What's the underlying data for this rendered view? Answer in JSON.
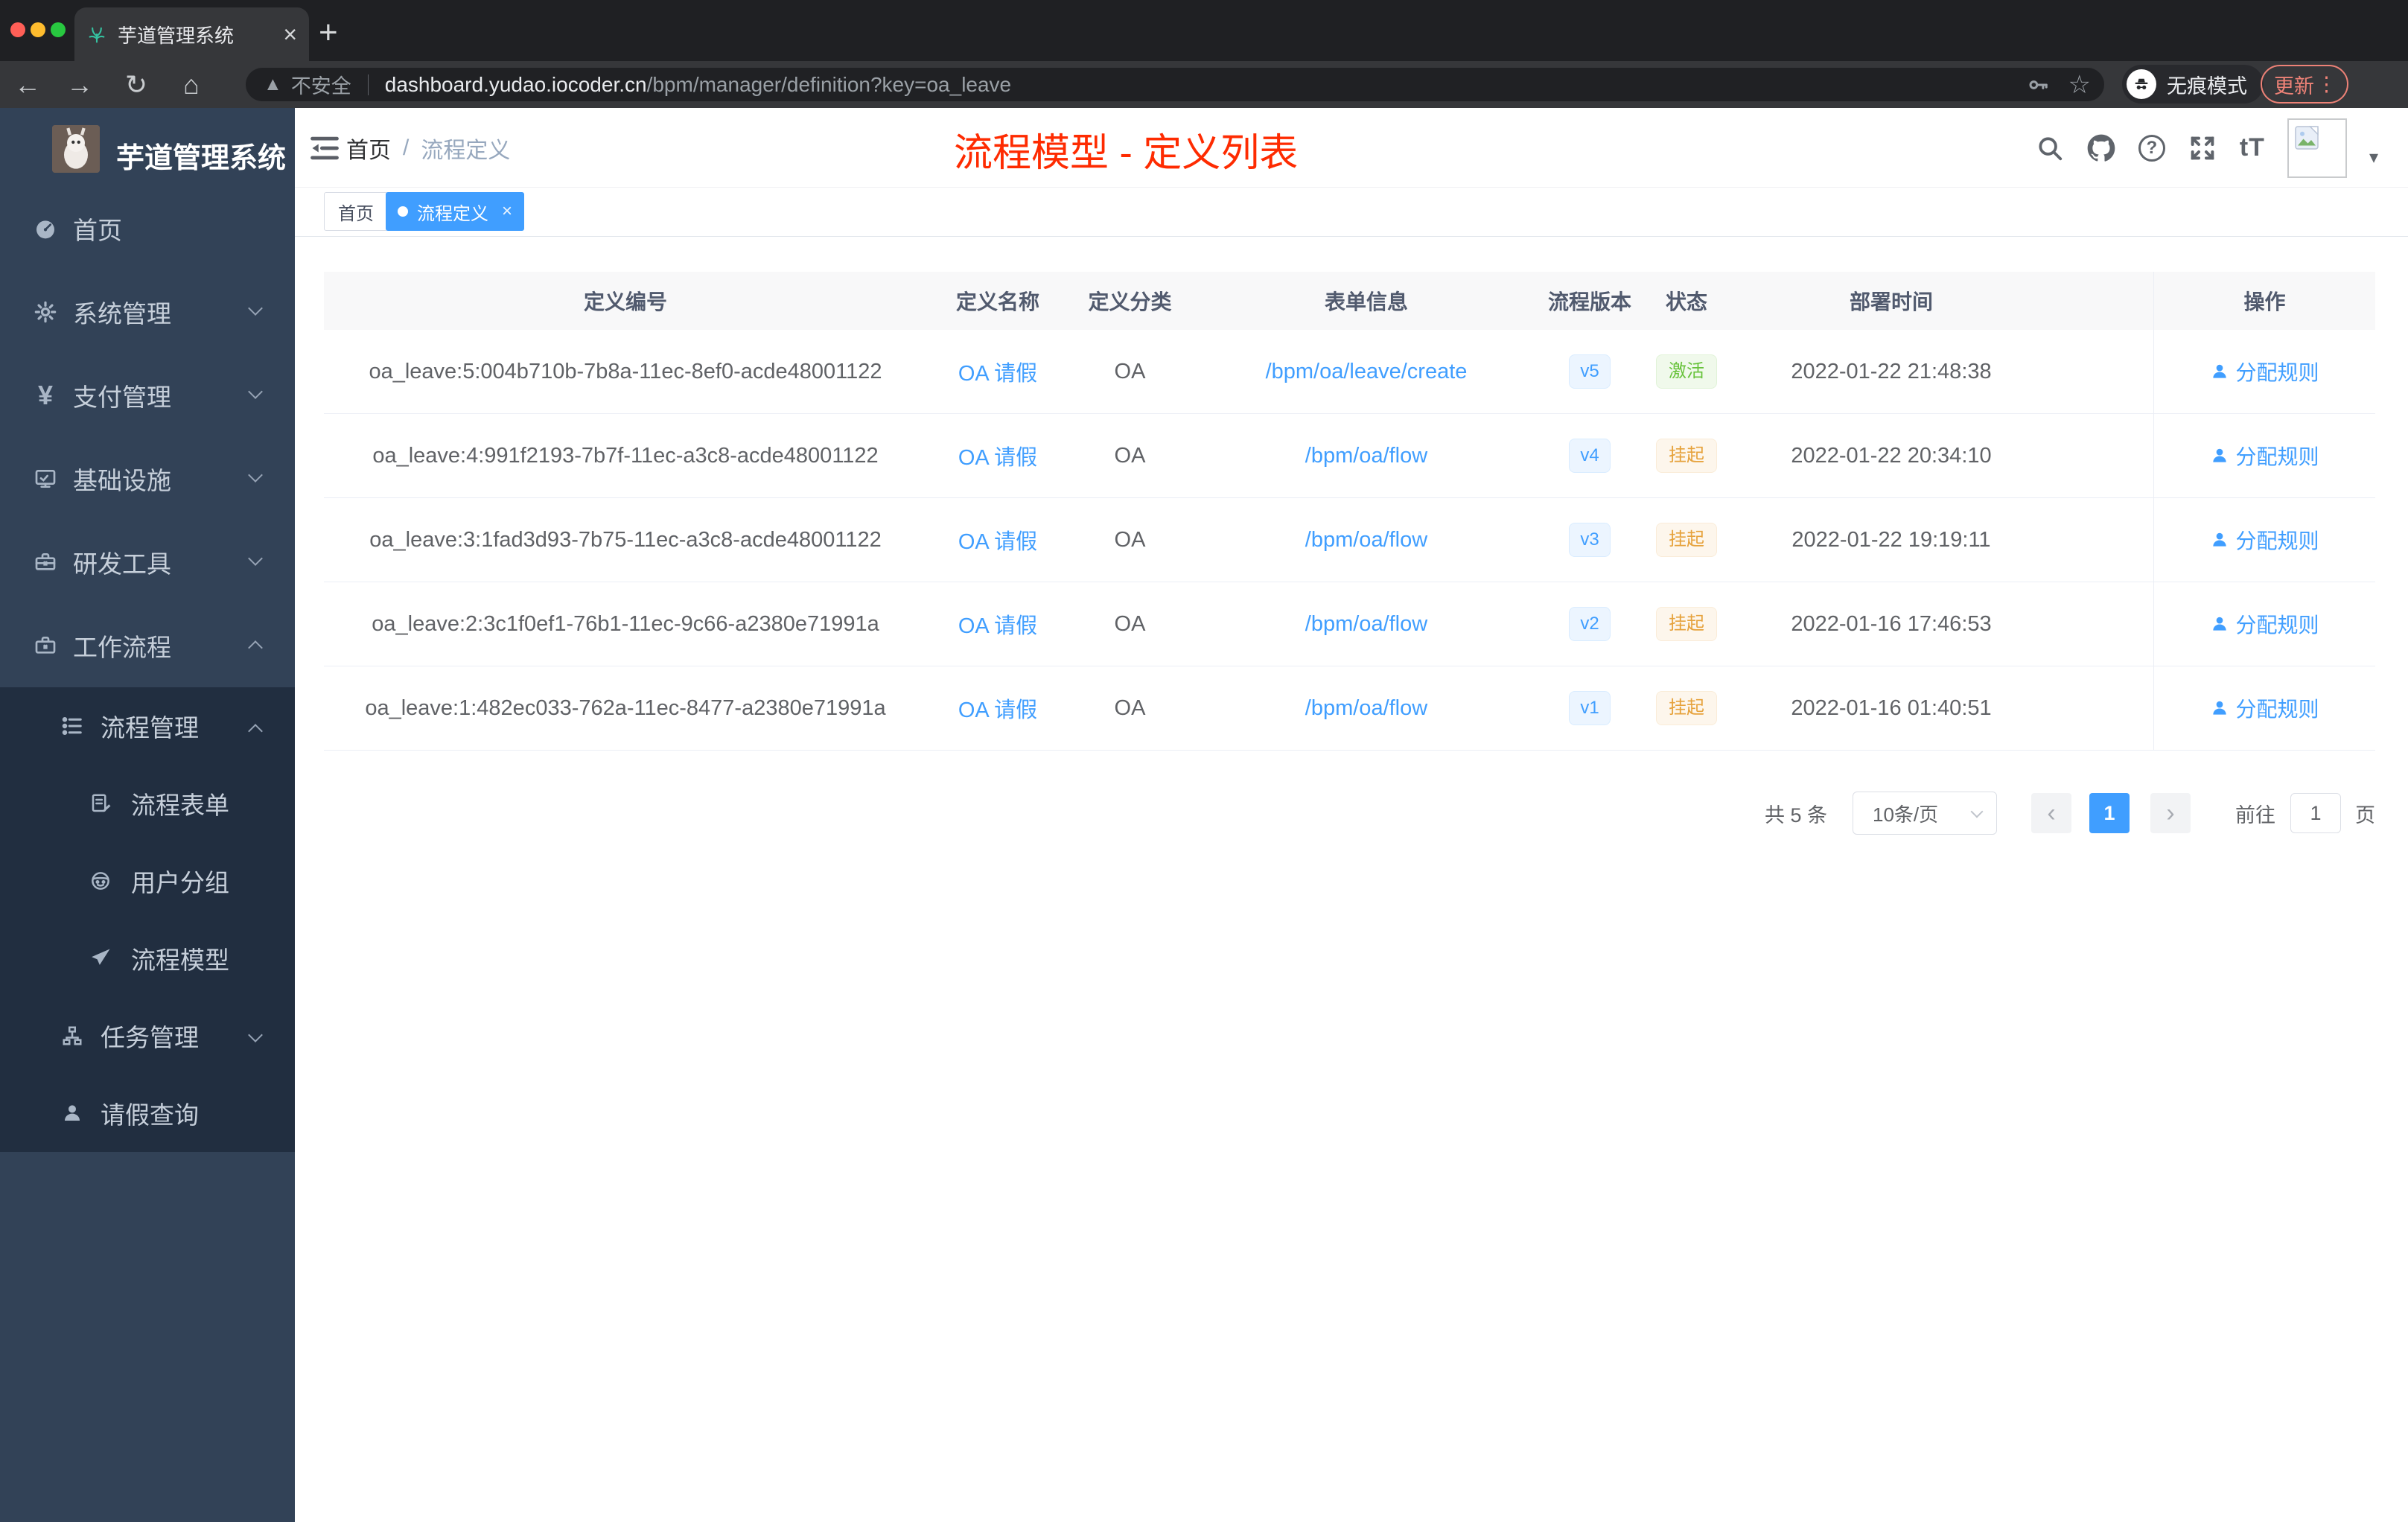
{
  "browser": {
    "tab": {
      "title": "芋道管理系统",
      "close": "×",
      "new_tab": "+"
    },
    "toolbar": {
      "security_label": "不安全",
      "url_domain": "dashboard.yudao.iocoder.cn",
      "url_path": "/bpm/manager/definition?key=oa_leave",
      "incognito_label": "无痕模式",
      "update_label": "更新"
    }
  },
  "sidebar": {
    "app_title": "芋道管理系统",
    "items": [
      {
        "label": "首页",
        "icon": "dashboard-icon"
      },
      {
        "label": "系统管理",
        "icon": "gear-icon"
      },
      {
        "label": "支付管理",
        "icon": "yen-icon"
      },
      {
        "label": "基础设施",
        "icon": "monitor-icon"
      },
      {
        "label": "研发工具",
        "icon": "toolbox-icon"
      },
      {
        "label": "工作流程",
        "icon": "briefcase-icon"
      },
      {
        "label": "流程管理",
        "icon": "list-icon"
      },
      {
        "label": "流程表单",
        "icon": "form-icon"
      },
      {
        "label": "用户分组",
        "icon": "robot-icon"
      },
      {
        "label": "流程模型",
        "icon": "send-icon"
      },
      {
        "label": "任务管理",
        "icon": "tree-icon"
      },
      {
        "label": "请假查询",
        "icon": "user-icon"
      }
    ]
  },
  "header": {
    "breadcrumb": {
      "root": "首页",
      "separator": "/",
      "current": "流程定义"
    },
    "annotation": "流程模型 - 定义列表"
  },
  "tags": {
    "home": "首页",
    "active": "流程定义",
    "close": "×"
  },
  "table": {
    "columns": [
      "定义编号",
      "定义名称",
      "定义分类",
      "表单信息",
      "流程版本",
      "状态",
      "部署时间",
      "操作"
    ],
    "action_label": "分配规则",
    "rows": [
      {
        "id": "oa_leave:5:004b710b-7b8a-11ec-8ef0-acde48001122",
        "name": "OA 请假",
        "category": "OA",
        "form": "/bpm/oa/leave/create",
        "version": "v5",
        "status": "激活",
        "deployed": "2022-01-22 21:48:38"
      },
      {
        "id": "oa_leave:4:991f2193-7b7f-11ec-a3c8-acde48001122",
        "name": "OA 请假",
        "category": "OA",
        "form": "/bpm/oa/flow",
        "version": "v4",
        "status": "挂起",
        "deployed": "2022-01-22 20:34:10"
      },
      {
        "id": "oa_leave:3:1fad3d93-7b75-11ec-a3c8-acde48001122",
        "name": "OA 请假",
        "category": "OA",
        "form": "/bpm/oa/flow",
        "version": "v3",
        "status": "挂起",
        "deployed": "2022-01-22 19:19:11"
      },
      {
        "id": "oa_leave:2:3c1f0ef1-76b1-11ec-9c66-a2380e71991a",
        "name": "OA 请假",
        "category": "OA",
        "form": "/bpm/oa/flow",
        "version": "v2",
        "status": "挂起",
        "deployed": "2022-01-16 17:46:53"
      },
      {
        "id": "oa_leave:1:482ec033-762a-11ec-8477-a2380e71991a",
        "name": "OA 请假",
        "category": "OA",
        "form": "/bpm/oa/flow",
        "version": "v1",
        "status": "挂起",
        "deployed": "2022-01-16 01:40:51"
      }
    ]
  },
  "pagination": {
    "total": "共 5 条",
    "page_size": "10条/页",
    "prev": "‹",
    "page": "1",
    "next": "›",
    "goto": "前往",
    "page_input": "1",
    "unit": "页"
  },
  "colors": {
    "accent": "#409eff",
    "status_active": "#67c23a",
    "status_suspend": "#e6a23c",
    "annotation_red": "#fe2b01",
    "sidebar_bg": "#324257",
    "sidebar_submenu_bg": "#212e40"
  }
}
